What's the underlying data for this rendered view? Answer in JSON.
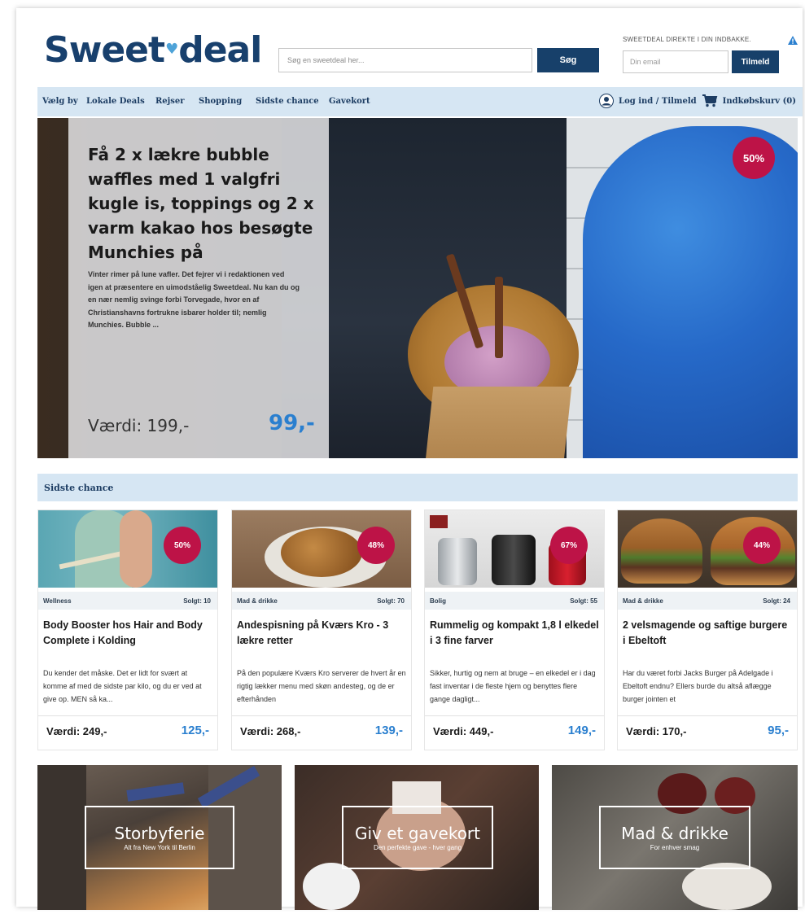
{
  "header": {
    "logo": "Sweet♥deal",
    "logo_part1": "Sweet",
    "logo_part2": "deal",
    "search_placeholder": "Søg en sweetdeal her...",
    "search_button": "Søg",
    "newsletter_label": "SWEETDEAL DIREKTE I DIN INDBAKKE.",
    "email_placeholder": "Din email",
    "subscribe_button": "Tilmeld"
  },
  "nav": {
    "items": [
      "Vælg by",
      "Lokale Deals",
      "Rejser",
      "Shopping",
      "Sidste chance",
      "Gavekort"
    ],
    "login_label": "Log ind  /  Tilmeld",
    "cart_label": "Indkøbskurv (0)"
  },
  "hero": {
    "title": "Få 2 x lækre bubble waffles med 1 valgfri kugle is, toppings og 2 x varm kakao hos besøgte Munchies på",
    "description": "Vinter rimer på lune vafler. Det fejrer vi i redaktionen ved igen at præsentere en uimodståelig Sweetdeal. Nu kan du og en nær nemlig svinge forbi Torvegade, hvor en af Christianshavns fortrukne isbarer holder til; nemlig Munchies. Bubble ...",
    "value": "Værdi: 199,-",
    "price": "99,-",
    "discount": "50%"
  },
  "section": {
    "title": "Sidste chance"
  },
  "deals": [
    {
      "category": "Wellness",
      "sold": "Solgt: 10",
      "discount": "50%",
      "title": "Body Booster hos Hair and Body Complete i Kolding",
      "description": "Du kender det måske. Det er lidt for svært at komme af med de sidste par kilo, og du er ved at give op. MEN så ka...",
      "value": "Værdi: 249,-",
      "price": "125,-"
    },
    {
      "category": "Mad & drikke",
      "sold": "Solgt: 70",
      "discount": "48%",
      "title": "Andespisning på Kværs Kro - 3 lækre retter",
      "description": "På den populære Kværs Kro serverer de hvert år en rigtig lækker menu med skøn andesteg, og de er efterhånden",
      "value": "Værdi: 268,-",
      "price": "139,-"
    },
    {
      "category": "Bolig",
      "sold": "Solgt: 55",
      "discount": "67%",
      "title": "Rummelig og kompakt 1,8 l elkedel i 3 fine farver",
      "description": "Sikker, hurtig og nem at bruge – en elkedel er i dag fast inventar i de fleste hjem og benyttes flere gange dagligt...",
      "value": "Værdi: 449,-",
      "price": "149,-"
    },
    {
      "category": "Mad & drikke",
      "sold": "Solgt: 24",
      "discount": "44%",
      "title": "2 velsmagende og saftige burgere i Ebeltoft",
      "description": "Har du været forbi Jacks Burger på Adelgade i Ebeltoft endnu? Ellers burde du altså aflægge burger jointen et",
      "value": "Værdi: 170,-",
      "price": "95,-"
    }
  ],
  "tiles": [
    {
      "title": "Storbyferie",
      "subtitle": "Alt fra New York til Berlin"
    },
    {
      "title": "Giv et gavekort",
      "subtitle": "Den perfekte gave - hver gang"
    },
    {
      "title": "Mad & drikke",
      "subtitle": "For enhver smag"
    }
  ],
  "colors": {
    "brand_navy": "#17406a",
    "accent_blue": "#2a7fcf",
    "badge_red": "#bd1347",
    "nav_bg": "#d6e6f3"
  }
}
